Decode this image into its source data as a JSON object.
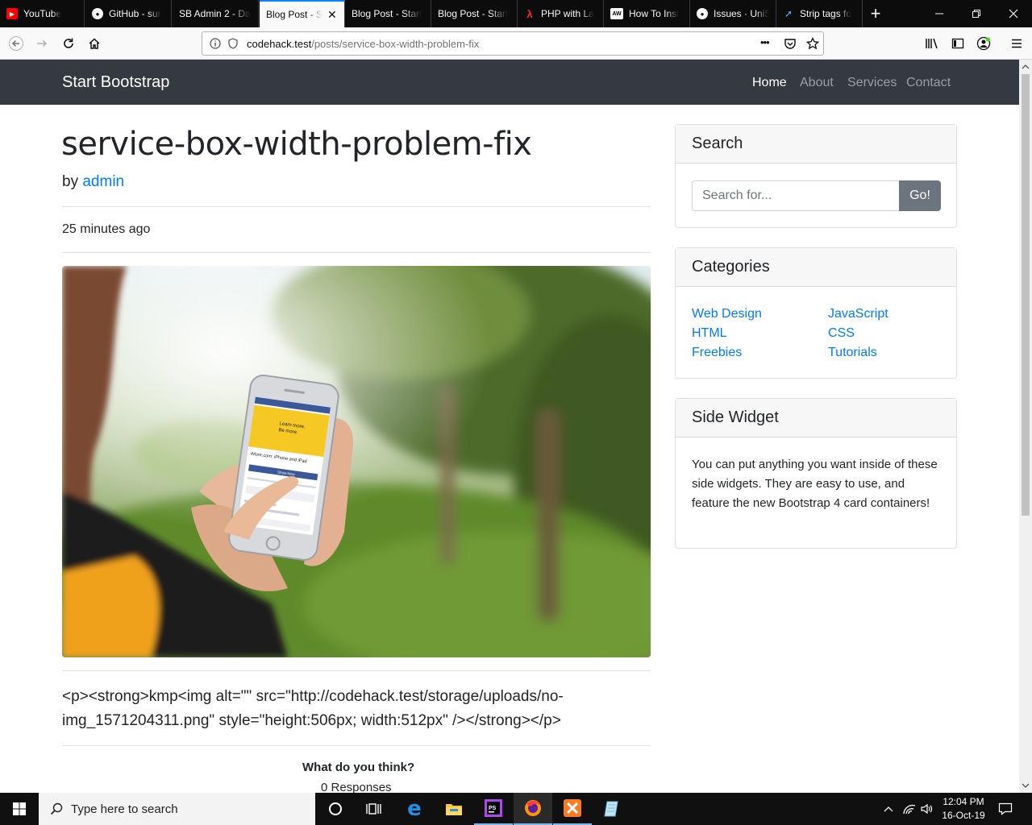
{
  "browser": {
    "tabs": [
      {
        "title": "YouTube",
        "favicon": "youtube-icon",
        "active": false
      },
      {
        "title": "GitHub - sur",
        "favicon": "github-icon",
        "active": false
      },
      {
        "title": "SB Admin 2 - Da",
        "favicon": "blank-page-icon",
        "active": false
      },
      {
        "title": "Blog Post - S",
        "favicon": "blank-page-icon",
        "active": true
      },
      {
        "title": "Blog Post - Start",
        "favicon": "blank-page-icon",
        "active": false
      },
      {
        "title": "Blog Post - Start",
        "favicon": "blank-page-icon",
        "active": false
      },
      {
        "title": "PHP with La",
        "favicon": "laracasts-icon",
        "active": false
      },
      {
        "title": "How To Inst",
        "favicon": "aw-icon",
        "active": false
      },
      {
        "title": "Issues · UniS",
        "favicon": "github-icon",
        "active": false
      },
      {
        "title": "Strip tags fo",
        "favicon": "tool-icon",
        "active": false
      }
    ],
    "new_tab_label": "+",
    "url_host": "codehack.test",
    "url_path": "/posts/service-box-width-problem-fix",
    "page_actions_label": "•••",
    "accent_color": "#0a84ff"
  },
  "site": {
    "brand": "Start Bootstrap",
    "nav": [
      {
        "label": "Home",
        "active": true
      },
      {
        "label": "About",
        "active": false
      },
      {
        "label": "Services",
        "active": false
      },
      {
        "label": "Contact",
        "active": false
      }
    ],
    "navbar_color": "#343a40",
    "link_color": "#007bff"
  },
  "post": {
    "title": "service-box-width-problem-fix",
    "by_prefix": "by",
    "author": "admin",
    "posted": "25 minutes ago",
    "image_alt": "hand holding a smartphone showing a Facebook page outdoors",
    "body_text": "<p><strong>kmp<img alt=\"\" src=\"http://codehack.test/storage/uploads/no-img_1571204311.png\" style=\"height:506px; width:512px\" /></strong></p>",
    "comments_heading": "What do you think?",
    "comments_count": "0 Responses",
    "phone_screen": {
      "banner_line1": "Learn more.",
      "banner_line2": "Be more.",
      "caption": "iMore.com: iPhone and iPad",
      "button": "Show Now"
    }
  },
  "sidebar": {
    "search": {
      "title": "Search",
      "placeholder": "Search for...",
      "button": "Go!"
    },
    "categories": {
      "title": "Categories",
      "left": [
        "Web Design",
        "HTML",
        "Freebies"
      ],
      "right": [
        "JavaScript",
        "CSS",
        "Tutorials"
      ]
    },
    "widget": {
      "title": "Side Widget",
      "text": "You can put anything you want inside of these side widgets. They are easy to use, and feature the new Bootstrap 4 card containers!"
    }
  },
  "taskbar": {
    "search_placeholder": "Type here to search",
    "time": "12:04 PM",
    "date": "16-Oct-19",
    "apps": [
      "task-view-icon",
      "edge-icon",
      "file-explorer-icon",
      "phpstorm-icon",
      "firefox-icon",
      "xampp-icon",
      "notepad-icon"
    ]
  }
}
